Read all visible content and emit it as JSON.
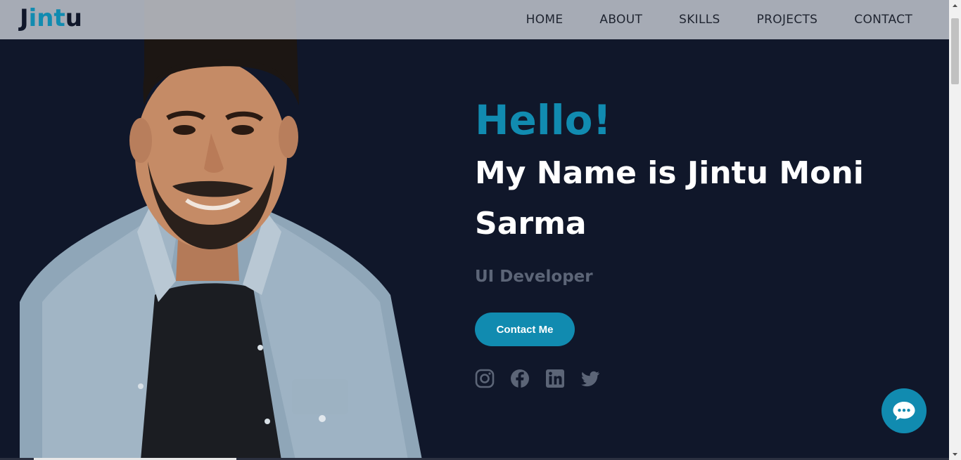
{
  "header": {
    "logo_prefix": "J",
    "logo_accent": "int",
    "logo_suffix": "u",
    "nav": [
      {
        "label": "HOME"
      },
      {
        "label": "ABOUT"
      },
      {
        "label": "SKILLS"
      },
      {
        "label": "PROJECTS"
      },
      {
        "label": "CONTACT"
      }
    ]
  },
  "hero": {
    "greeting": "Hello!",
    "name_line1": "My Name is Jintu Moni",
    "name_line2": "Sarma",
    "role": "UI Developer",
    "cta_label": "Contact Me"
  },
  "socials": [
    {
      "icon": "instagram-icon"
    },
    {
      "icon": "facebook-icon"
    },
    {
      "icon": "linkedin-icon"
    },
    {
      "icon": "twitter-icon"
    }
  ],
  "chat": {
    "icon": "chat-bubble-icon"
  },
  "colors": {
    "accent": "#118bb0",
    "background": "#10172a",
    "muted": "#5c6577"
  }
}
